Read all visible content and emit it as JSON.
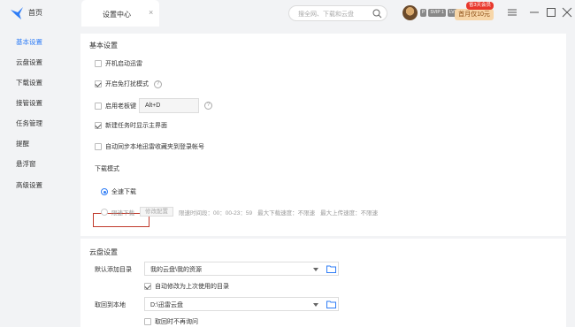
{
  "topbar": {
    "home_label": "首页",
    "tab_label": "设置中心",
    "tab_close": "×",
    "search_placeholder": "搜全网、下载和云盘",
    "badges": [
      "P",
      "SVIP 1",
      "LV1"
    ],
    "promo_label": "首月仅10元",
    "promo_tag": "省3天会员"
  },
  "sidebar": {
    "items": [
      {
        "label": "基本设置",
        "active": true
      },
      {
        "label": "云盘设置",
        "active": false
      },
      {
        "label": "下载设置",
        "active": false
      },
      {
        "label": "接管设置",
        "active": false
      },
      {
        "label": "任务管理",
        "active": false
      },
      {
        "label": "提醒",
        "active": false
      },
      {
        "label": "悬浮窗",
        "active": false
      },
      {
        "label": "高级设置",
        "active": false
      }
    ]
  },
  "basic": {
    "title": "基本设置",
    "autostart": {
      "label": "开机启动迅雷",
      "checked": false
    },
    "no_disturb": {
      "label": "开启免打扰模式",
      "checked": true
    },
    "boss_key": {
      "label": "启用老板键",
      "checked": false,
      "value": "Alt+D"
    },
    "show_main": {
      "label": "新建任务时显示主界面",
      "checked": true
    },
    "sync_fav": {
      "label": "自动同步本地迅雷收藏夹到登录帐号",
      "checked": false
    },
    "download_mode_title": "下载模式",
    "full_speed": {
      "label": "全速下载",
      "selected": true
    },
    "limited": {
      "label": "限速下载",
      "modify_button": "修改配置",
      "time_range": "限速时间段：00：00-23：59",
      "max_download": "最大下载速度：不限速",
      "max_upload": "最大上传速度：不限速",
      "selected": false
    }
  },
  "cloud": {
    "title": "云盘设置",
    "default_dir_label": "默认添加目录",
    "default_dir_value": "我的云盘\\我的资源",
    "auto_modify": {
      "label": "自动修改为上次使用的目录",
      "checked": true
    },
    "fetch_local_label": "取回到本地",
    "fetch_local_value": "D:\\迅雷云盘",
    "no_ask": {
      "label": "取回时不再询问",
      "checked": false
    }
  },
  "colors": {
    "accent": "#2f7df6",
    "highlight_border": "#c0392b",
    "promo_bg": "#f7d6a8",
    "promo_tag": "#e8372c"
  }
}
